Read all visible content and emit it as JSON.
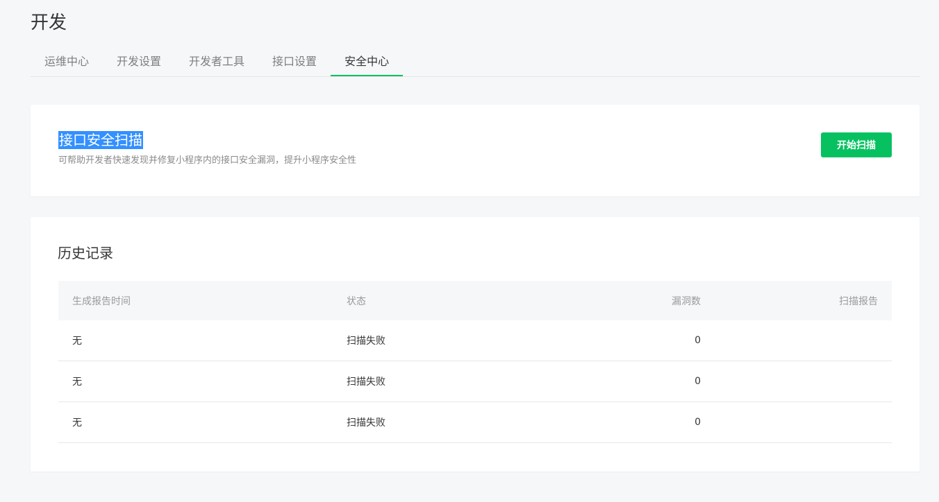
{
  "page": {
    "title": "开发"
  },
  "tabs": [
    {
      "label": "运维中心",
      "active": false
    },
    {
      "label": "开发设置",
      "active": false
    },
    {
      "label": "开发者工具",
      "active": false
    },
    {
      "label": "接口设置",
      "active": false
    },
    {
      "label": "安全中心",
      "active": true
    }
  ],
  "scan": {
    "title": "接口安全扫描",
    "description": "可帮助开发者快速发现并修复小程序内的接口安全漏洞，提升小程序安全性",
    "button_label": "开始扫描"
  },
  "history": {
    "title": "历史记录",
    "columns": [
      "生成报告时间",
      "状态",
      "漏洞数",
      "扫描报告"
    ],
    "rows": [
      {
        "time": "无",
        "status": "扫描失败",
        "count": "0",
        "report": ""
      },
      {
        "time": "无",
        "status": "扫描失败",
        "count": "0",
        "report": ""
      },
      {
        "time": "无",
        "status": "扫描失败",
        "count": "0",
        "report": ""
      }
    ]
  },
  "colors": {
    "accent": "#07c160",
    "selection": "#3390ff"
  }
}
